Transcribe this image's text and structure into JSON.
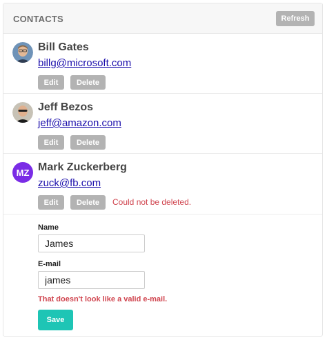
{
  "header": {
    "title": "CONTACTS",
    "refresh_label": "Refresh"
  },
  "contacts": [
    {
      "name": "Bill Gates",
      "email": "billg@microsoft.com",
      "edit_label": "Edit",
      "delete_label": "Delete",
      "avatar": "photo"
    },
    {
      "name": "Jeff Bezos",
      "email": "jeff@amazon.com",
      "edit_label": "Edit",
      "delete_label": "Delete",
      "avatar": "photo"
    },
    {
      "name": "Mark Zuckerberg",
      "email": "zuck@fb.com",
      "edit_label": "Edit",
      "delete_label": "Delete",
      "avatar_initials": "MZ",
      "avatar_color": "#7a2ce6",
      "error": "Could not be deleted."
    }
  ],
  "form": {
    "name_label": "Name",
    "name_value": "James",
    "email_label": "E-mail",
    "email_value": "james",
    "email_error": "That doesn't look like a valid e-mail.",
    "save_label": "Save"
  },
  "colors": {
    "accent": "#1ec5b5",
    "error": "#d0454f",
    "button_gray": "#b3b3b3",
    "link": "#1a0dab"
  }
}
